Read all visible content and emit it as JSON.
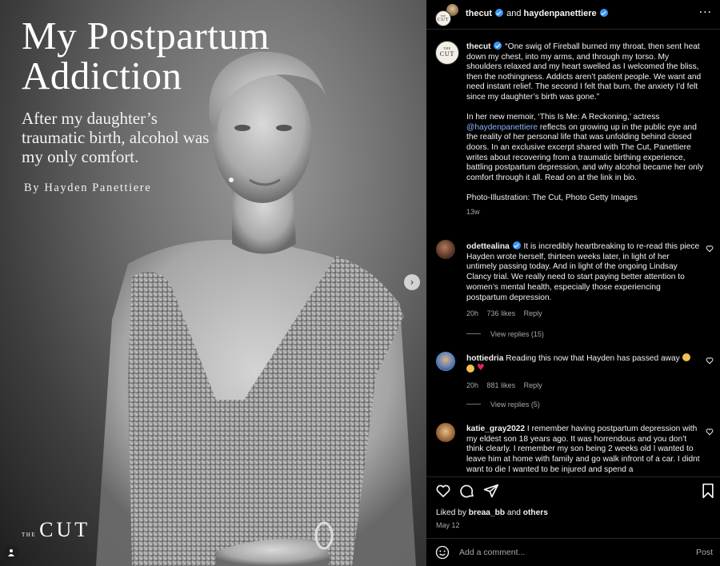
{
  "image": {
    "headline": "My Postpartum Addiction",
    "subhead": "After my daughter’s traumatic birth, alcohol was my only comfort.",
    "byline": "By Hayden Panettiere",
    "logo_small": "THE",
    "logo_big": "CUT"
  },
  "header": {
    "account1": "thecut",
    "and_text": " and ",
    "account2": "haydenpanettiere",
    "more_glyph": "···"
  },
  "avatar_logo": {
    "small": "THE",
    "big": "CUT"
  },
  "caption": {
    "username": "thecut",
    "para1": "“One swig of Fireball burned my throat, then sent heat down my chest, into my arms, and through my torso. My shoulders relaxed and my heart swelled as I welcomed the bliss, then the nothingness. Addicts aren’t patient people. We want and need instant relief. The second I felt that burn, the anxiety I’d felt since my daughter’s birth was gone.”",
    "para2_before": "In her new memoir, ‘This Is Me: A Reckoning,’ actress ",
    "para2_mention": "@haydenpanettiere",
    "para2_after": " reflects on growing up in the public eye and the reality of her personal life that was unfolding behind closed doors. In an exclusive excerpt shared with The Cut, Panettiere writes about recovering from a traumatic birthing experience, battling postpartum depression, and why alcohol became her only comfort through it all. Read on at the link in bio.",
    "para3": "Photo-Illustration: The Cut, Photo Getty Images",
    "time": "13w"
  },
  "comments": [
    {
      "username": "odettealina",
      "text": "It is incredibly heartbreaking to re-read this piece Hayden wrote herself, thirteen weeks later, in light of her untimely passing today. And in light of the ongoing Lindsay Clancy trial. We really need to start paying better attention to women’s mental health, especially those experiencing postpartum depression.",
      "time": "20h",
      "likes": "736 likes",
      "reply": "Reply",
      "view_replies": "View replies (15)"
    },
    {
      "username": "hottiedria",
      "text": "Reading this now that Hayden has passed away",
      "time": "20h",
      "likes": "881 likes",
      "reply": "Reply",
      "view_replies": "View replies (5)"
    },
    {
      "username": "katie_gray2022",
      "text": "I remember having postpartum depression with my eldest son 18 years ago. It was horrendous and you don’t think clearly. I remember my son being 2 weeks old I wanted to leave him at home with family and go walk infront of a car. I didnt want to die I wanted to be injured and spend a"
    }
  ],
  "liked_by": {
    "prefix": "Liked by ",
    "user": "breaa_bb",
    "middle": " and ",
    "others": "others"
  },
  "post_date": "May 12",
  "add_comment": {
    "placeholder": "Add a comment...",
    "post_label": "Post"
  },
  "colors": {
    "verified": "#3897f0",
    "mention": "#8ab4f8",
    "muted": "#a8a8a8",
    "background": "#000000"
  }
}
